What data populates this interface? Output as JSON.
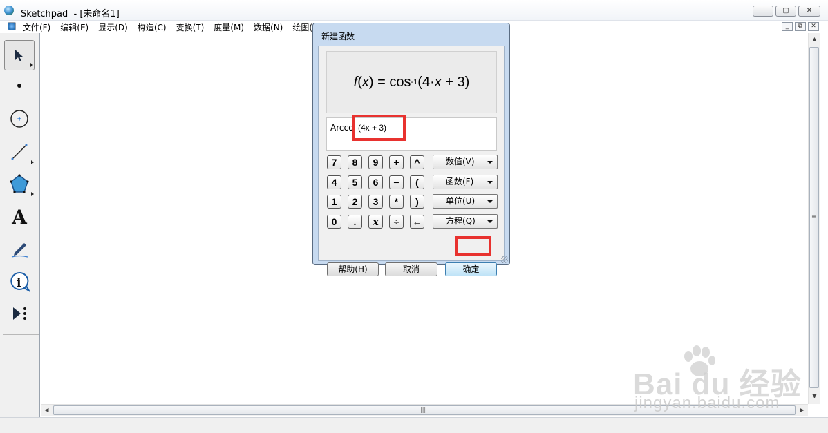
{
  "window": {
    "title": "Sketchpad  - [未命名1]",
    "buttons": [
      "─",
      "▢",
      "✕"
    ]
  },
  "menu": {
    "items": [
      "文件(F)",
      "编辑(E)",
      "显示(D)",
      "构造(C)",
      "变换(T)",
      "度量(M)",
      "数据(N)",
      "绘图(G"
    ],
    "mdi_buttons": [
      "_",
      "⧉",
      "✕"
    ]
  },
  "toolbox": {
    "tools": [
      {
        "name": "arrow-tool",
        "glyph": "➤"
      },
      {
        "name": "point-tool",
        "glyph": "•"
      },
      {
        "name": "compass-tool",
        "glyph": "⊕"
      },
      {
        "name": "line-tool",
        "glyph": "╱"
      },
      {
        "name": "polygon-tool",
        "glyph": "⬟"
      },
      {
        "name": "text-tool",
        "glyph": "A"
      },
      {
        "name": "marker-tool",
        "glyph": "✎"
      },
      {
        "name": "info-tool",
        "glyph": "ⓘ"
      },
      {
        "name": "custom-tool",
        "glyph": "▶⁝"
      }
    ]
  },
  "scrollbars": {
    "up": "▲",
    "down": "▼",
    "left": "◀",
    "right": "▶",
    "grip_v": "≡",
    "grip_h": "|||"
  },
  "dialog": {
    "title": "新建函数",
    "preview": {
      "f": "f",
      "open": "(",
      "x": "x",
      "close": ")",
      "eq": " = cos",
      "sup": "-1",
      "arg_open": "(4·",
      "arg_x": "x",
      "arg_rest": " + 3)"
    },
    "expression": {
      "prefix": "Arcco",
      "arg": "(4x + 3)"
    },
    "keypad": [
      [
        "7",
        "8",
        "9",
        "+",
        "^"
      ],
      [
        "4",
        "5",
        "6",
        "−",
        "("
      ],
      [
        "1",
        "2",
        "3",
        "*",
        ")"
      ],
      [
        "0",
        ".",
        "x",
        "÷",
        "←"
      ]
    ],
    "dropdowns": [
      "数值(V)",
      "函数(F)",
      "单位(U)",
      "方程(Q)"
    ],
    "buttons": {
      "help": "帮助(H)",
      "cancel": "取消",
      "ok": "确定"
    }
  },
  "watermark": {
    "logo": "Bai du 经验",
    "url": "jingyan.baidu.com"
  },
  "colors": {
    "highlight": "#e8322f",
    "dialog_frame": "#c7daf0"
  }
}
